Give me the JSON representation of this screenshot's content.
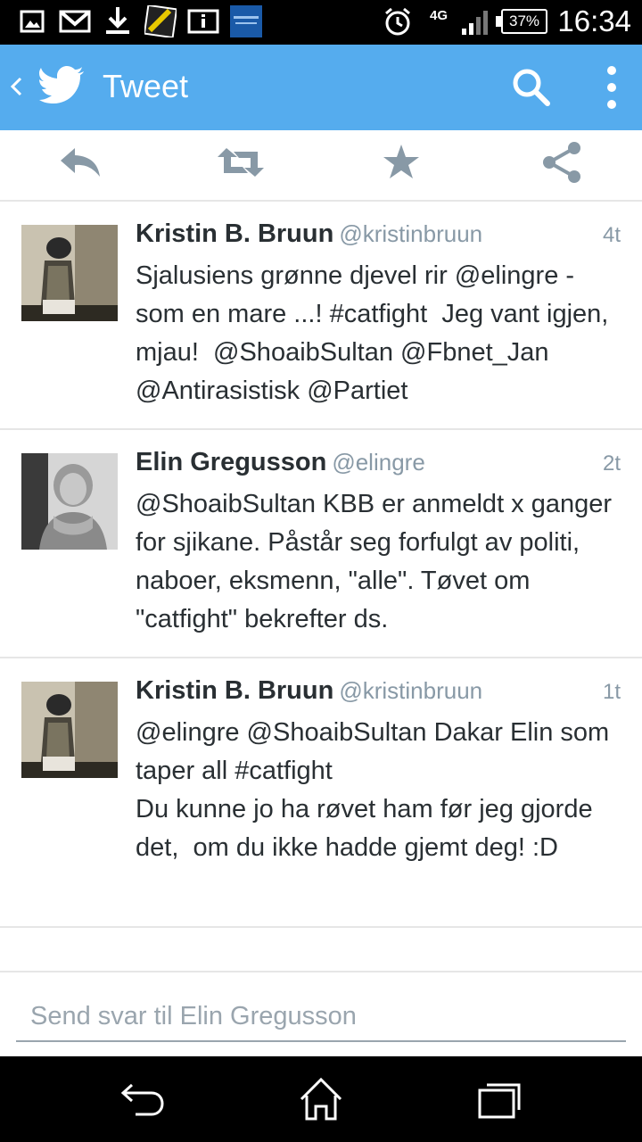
{
  "status_bar": {
    "time": "16:34",
    "battery": "37%",
    "network": "4G",
    "icons": [
      "gallery-icon",
      "gmail-icon",
      "download-icon",
      "game-icon",
      "info-icon",
      "xperia-lounge-icon",
      "alarm-icon",
      "signal-icon",
      "battery-icon"
    ]
  },
  "action_bar": {
    "title": "Tweet",
    "color": "#55acee"
  },
  "tweet_actions": [
    "reply-icon",
    "retweet-icon",
    "favorite-icon",
    "share-icon"
  ],
  "tweets": [
    {
      "name": "Kristin B. Bruun",
      "handle": "@kristinbruun",
      "time": "4t",
      "text": "Sjalusiens grønne djevel rir @elingre - som en mare ...! #catfight  Jeg vant igjen, mjau!  @ShoaibSultan @Fbnet_Jan @Antirasistisk @Partiet"
    },
    {
      "name": "Elin Gregusson",
      "handle": "@elingre",
      "time": "2t",
      "text": "@ShoaibSultan KBB er anmeldt x ganger for sjikane. Påstår seg forfulgt av politi, naboer, eksmenn, \"alle\". Tøvet om \"catfight\" bekrefter ds."
    },
    {
      "name": "Kristin B. Bruun",
      "handle": "@kristinbruun",
      "time": "1t",
      "text": "@elingre @ShoaibSultan Dakar Elin som taper all #catfight\nDu kunne jo ha røvet ham før jeg gjorde det,  om du ikke hadde gjemt deg! :D"
    }
  ],
  "reply": {
    "placeholder": "Send svar til Elin Gregusson"
  },
  "nav_bar": [
    "back-icon",
    "home-icon",
    "recent-apps-icon"
  ]
}
